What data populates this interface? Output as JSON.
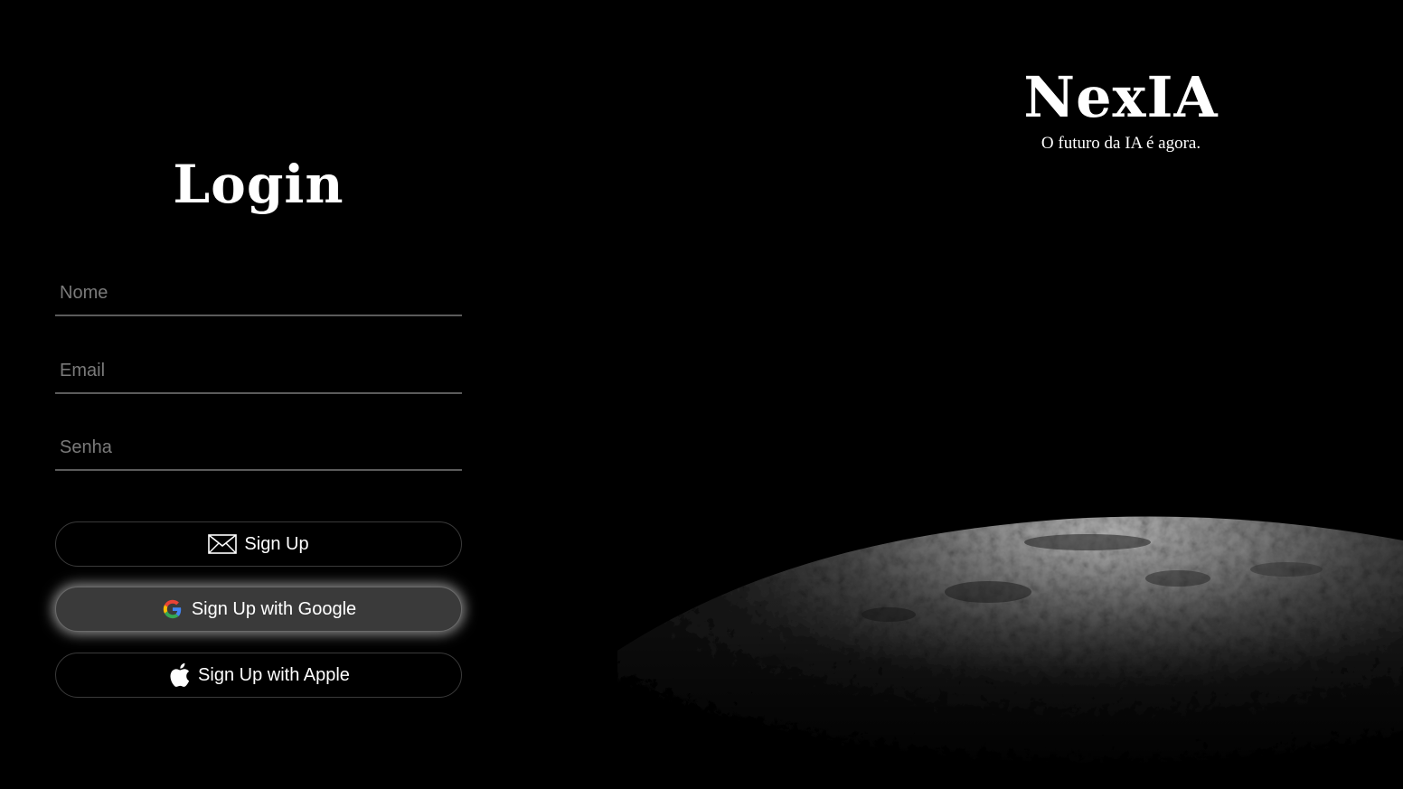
{
  "login": {
    "title": "Login",
    "fields": {
      "nome_placeholder": "Nome",
      "email_placeholder": "Email",
      "senha_placeholder": "Senha"
    },
    "buttons": {
      "signup_label": "Sign Up",
      "google_label": "Sign Up with Google",
      "apple_label": "Sign Up with Apple"
    },
    "icons": {
      "signup": "envelope-icon",
      "google": "google-icon",
      "apple": "apple-icon"
    }
  },
  "brand": {
    "name": "NexIA",
    "tagline": "O futuro da IA é agora."
  },
  "colors": {
    "background": "#000000",
    "text": "#ffffff",
    "google_button": "#3a3a3a",
    "underline": "#5b5b5b"
  }
}
